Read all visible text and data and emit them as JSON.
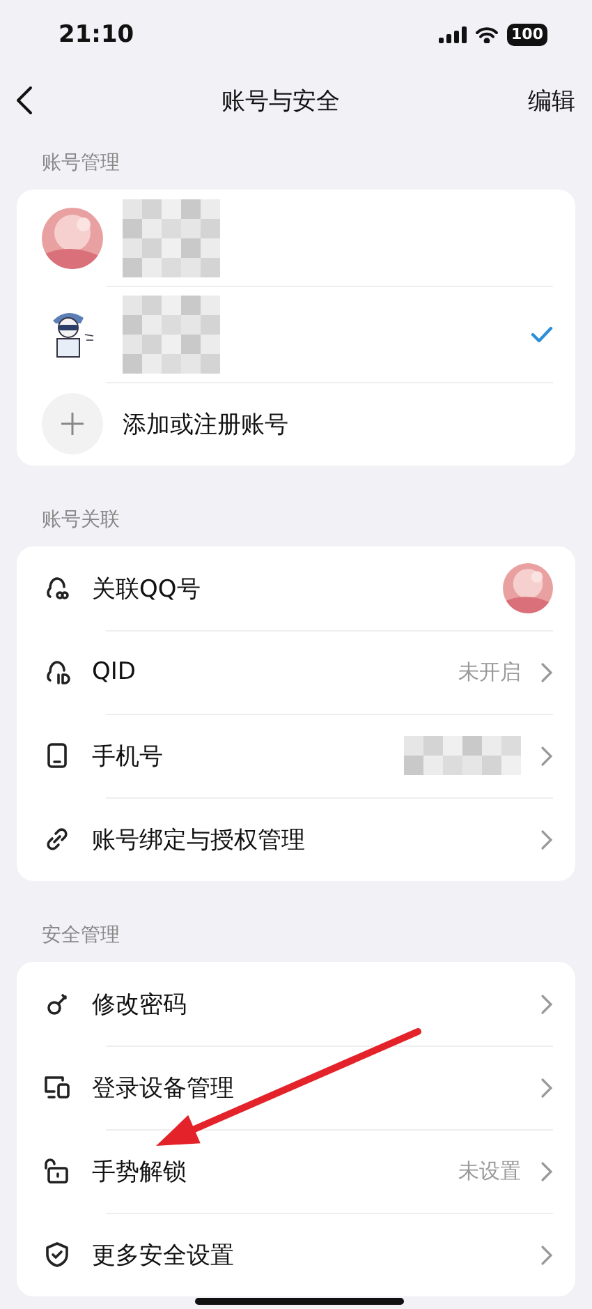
{
  "status_bar": {
    "time": "21:10",
    "battery": "100"
  },
  "nav": {
    "title": "账号与安全",
    "action": "编辑"
  },
  "account_section": {
    "header": "账号管理",
    "accounts": [
      {
        "selected": false
      },
      {
        "selected": true
      }
    ],
    "add_label": "添加或注册账号"
  },
  "sections": [
    {
      "header": "账号关联",
      "rows": [
        {
          "label": "关联QQ号",
          "kind": "avatar",
          "chevron": false
        },
        {
          "label": "QID",
          "kind": "value",
          "value": "未开启",
          "chevron": true
        },
        {
          "label": "手机号",
          "kind": "blurred",
          "chevron": true
        },
        {
          "label": "账号绑定与授权管理",
          "kind": "plain",
          "chevron": true
        }
      ]
    },
    {
      "header": "安全管理",
      "rows": [
        {
          "label": "修改密码",
          "kind": "plain",
          "chevron": true
        },
        {
          "label": "登录设备管理",
          "kind": "plain",
          "chevron": true
        },
        {
          "label": "手势解锁",
          "kind": "value",
          "value": "未设置",
          "chevron": true
        },
        {
          "label": "更多安全设置",
          "kind": "plain",
          "chevron": true
        }
      ]
    }
  ],
  "annotations": [
    {
      "kind": "arrow"
    }
  ]
}
